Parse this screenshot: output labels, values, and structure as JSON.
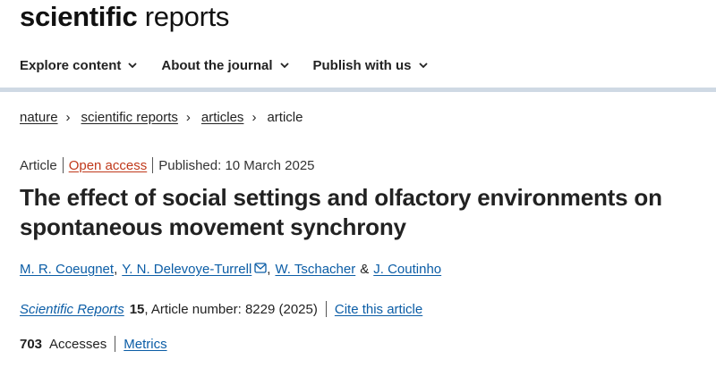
{
  "site": {
    "logo_bold": "scientific",
    "logo_light": "reports"
  },
  "nav": {
    "items": [
      {
        "label": "Explore content"
      },
      {
        "label": "About the journal"
      },
      {
        "label": "Publish with us"
      }
    ]
  },
  "breadcrumb": {
    "items": [
      "nature",
      "scientific reports",
      "articles"
    ],
    "current": "article",
    "separator": "›"
  },
  "article": {
    "type": "Article",
    "access": "Open access",
    "published": "Published: 10 March 2025",
    "title": "The effect of social settings and olfactory environments on spontaneous movement synchrony",
    "authors": [
      {
        "name": "M. R. Coeugnet"
      },
      {
        "name": "Y. N. Delevoye-Turrell",
        "icon": "mail-icon"
      },
      {
        "name": "W. Tschacher"
      },
      {
        "name": "J. Coutinho"
      }
    ],
    "author_sep_comma": ",",
    "author_sep_and": "&"
  },
  "citation": {
    "journal": "Scientific Reports",
    "volume": "15",
    "article_number": ", Article number: 8229 (2025)",
    "cite_label": "Cite this article"
  },
  "metrics": {
    "accesses_count": "703",
    "accesses_label": "Accesses",
    "metrics_link": "Metrics"
  },
  "colors": {
    "link": "#0b5da6",
    "open_access": "#c0391b",
    "divider": "#cfd9e4",
    "text": "#222222"
  }
}
